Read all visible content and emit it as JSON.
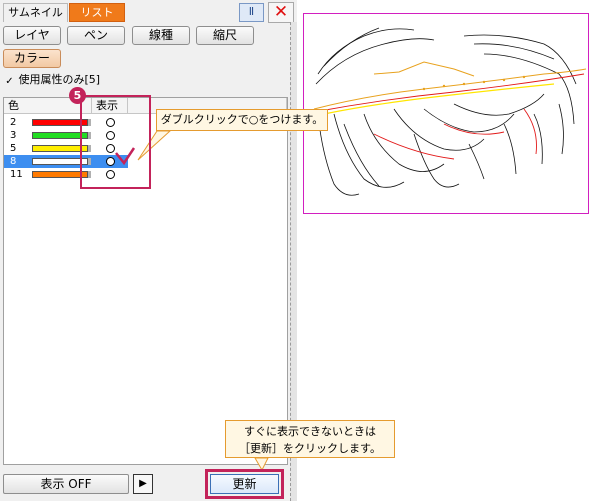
{
  "tabs": [
    {
      "label": "サムネイル",
      "active": false
    },
    {
      "label": "リスト",
      "active": true
    }
  ],
  "window_buttons": {
    "pin_label": "Ⅱ",
    "close_label": "✕"
  },
  "mode_buttons": [
    {
      "label": "レイヤ"
    },
    {
      "label": "ペン"
    },
    {
      "label": "線種"
    },
    {
      "label": "縮尺"
    },
    {
      "label": "カラー",
      "active": true
    }
  ],
  "used_only": {
    "label": "使用属性のみ[5]",
    "checked": true,
    "check_glyph": "✓"
  },
  "list": {
    "columns": [
      "色",
      "表示"
    ],
    "rows": [
      {
        "id": "2",
        "color": "#ff0000",
        "visible": true
      },
      {
        "id": "3",
        "color": "#22dd22",
        "visible": true
      },
      {
        "id": "5",
        "color": "#ffee00",
        "visible": true
      },
      {
        "id": "8",
        "color": "#ffffff",
        "visible": true,
        "selected": true
      },
      {
        "id": "11",
        "color": "#ff7a00",
        "visible": true
      }
    ]
  },
  "bottom_bar": {
    "display_off_label": "表示 OFF",
    "play_label": "▶",
    "update_label": "更新"
  },
  "annotations": {
    "step_number": "5",
    "callout_double_click": "ダブルクリックで○をつけます。",
    "callout_update_line1": "すぐに表示できないときは",
    "callout_update_line2": "［更新］をクリックします。"
  },
  "colors": {
    "accent_orange": "#f07a1a",
    "highlight_magenta": "#c3235a",
    "selection_blue": "#3d8ef0",
    "preview_border": "#d21fc0"
  }
}
